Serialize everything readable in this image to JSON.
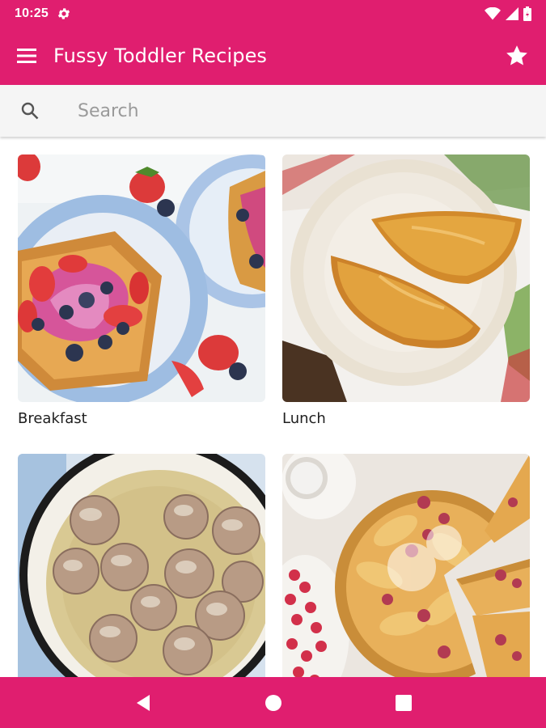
{
  "status_bar": {
    "time": "10:25",
    "icons": [
      "gear-icon",
      "wifi-icon",
      "signal-icon",
      "battery-icon"
    ]
  },
  "app_bar": {
    "title": "Fussy Toddler Recipes",
    "menu_icon": "hamburger-menu-icon",
    "action_icon": "star-icon"
  },
  "search": {
    "placeholder": "Search",
    "value": ""
  },
  "categories": [
    {
      "label": "Breakfast",
      "image": "french-toast-with-berries-photo"
    },
    {
      "label": "Lunch",
      "image": "empanadas-on-plate-photo"
    },
    {
      "label": "",
      "image": "meatballs-in-gravy-photo"
    },
    {
      "label": "",
      "image": "raspberry-tart-photo"
    }
  ],
  "nav_bar": {
    "buttons": [
      "back-icon",
      "home-icon",
      "recents-icon"
    ]
  },
  "colors": {
    "primary": "#e01e6f",
    "search_bg": "#f5f5f5",
    "text": "#202020"
  }
}
